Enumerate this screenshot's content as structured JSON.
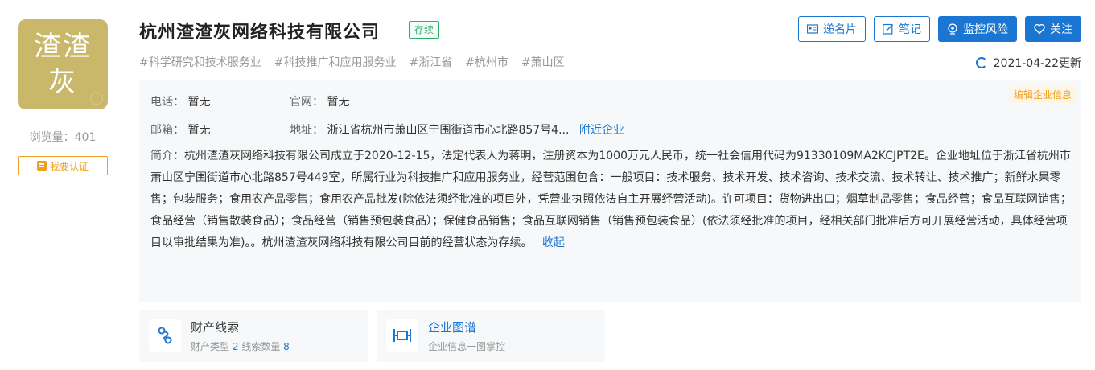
{
  "company": {
    "logo_text_line1": "渣渣",
    "logo_text_line2": "灰",
    "logo_color": "#c9b76a",
    "name": "杭州渣渣灰网络科技有限公司",
    "status": "存续"
  },
  "sidebar": {
    "views_label": "浏览量：",
    "views_count": "401",
    "claim_label": "我要认证"
  },
  "tags": [
    "#科学研究和技术服务业",
    "#科技推广和应用服务业",
    "#浙江省",
    "#杭州市",
    "#萧山区"
  ],
  "actions": {
    "card_label": "递名片",
    "notes_label": "笔记",
    "monitor_label": "监控风险",
    "follow_label": "关注"
  },
  "updated": "2021-04-22更新",
  "info": {
    "edit_label": "编辑企业信息",
    "phone_label": "电话：",
    "phone_value": "暂无",
    "website_label": "官网：",
    "website_value": "暂无",
    "email_label": "邮箱：",
    "email_value": "暂无",
    "address_label": "地址：",
    "address_value": "浙江省杭州市萧山区宁围街道市心北路857号4...",
    "nearby_label": "附近企业",
    "intro_label": "简介：",
    "intro_text": "杭州渣渣灰网络科技有限公司成立于2020-12-15，法定代表人为蒋明，注册资本为1000万元人民币，统一社会信用代码为91330109MA2KCJPT2E。企业地址位于浙江省杭州市萧山区宁围街道市心北路857号449室，所属行业为科技推广和应用服务业，经营范围包含：一般项目：技术服务、技术开发、技术咨询、技术交流、技术转让、技术推广；新鲜水果零售；包装服务；食用农产品零售；食用农产品批发(除依法须经批准的项目外，凭营业执照依法自主开展经营活动)。许可项目：货物进出口；烟草制品零售；食品经营；食品互联网销售；食品经营（销售散装食品）；食品经营（销售预包装食品）；保健食品销售；食品互联网销售（销售预包装食品）(依法须经批准的项目，经相关部门批准后方可开展经营活动，具体经营项目以审批结果为准)。。杭州渣渣灰网络科技有限公司目前的经营状态为存续。",
    "collapse_label": "收起"
  },
  "cards": {
    "asset": {
      "title": "财产线索",
      "type_label": "财产类型",
      "type_count": "2",
      "clue_label": "线索数量",
      "clue_count": "8"
    },
    "graph": {
      "title": "企业图谱",
      "subtitle": "企业信息一图掌控"
    }
  }
}
